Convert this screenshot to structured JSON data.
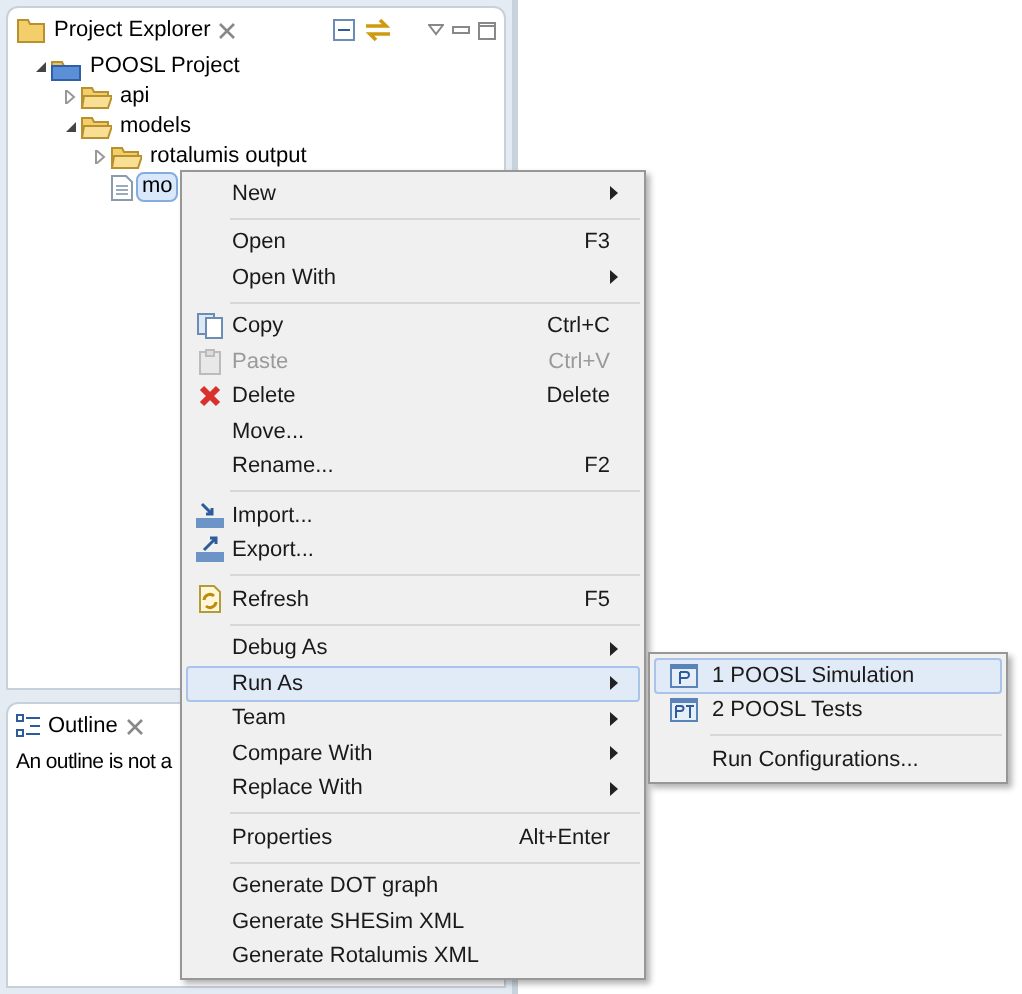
{
  "explorer": {
    "title": "Project Explorer",
    "tree": [
      {
        "label": "POOSL Project",
        "kind": "project",
        "expanded": true,
        "selected": false,
        "children": [
          {
            "label": "api",
            "kind": "folder",
            "expanded": false,
            "selected": false
          },
          {
            "label": "models",
            "kind": "folder",
            "expanded": true,
            "selected": false,
            "children": [
              {
                "label": "rotalumis output",
                "kind": "folder",
                "expanded": false,
                "selected": false
              },
              {
                "label": "mo",
                "kind": "file",
                "selected": true
              }
            ]
          }
        ]
      }
    ]
  },
  "outline": {
    "title": "Outline",
    "message": "An outline is not a"
  },
  "context_menu": {
    "items": [
      {
        "kind": "item",
        "label": "New",
        "submenu": true,
        "disabled": false,
        "selected": false
      },
      {
        "kind": "separator"
      },
      {
        "kind": "item",
        "label": "Open",
        "shortcut": "F3",
        "disabled": false,
        "selected": false
      },
      {
        "kind": "item",
        "label": "Open With",
        "submenu": true,
        "disabled": false,
        "selected": false
      },
      {
        "kind": "separator"
      },
      {
        "kind": "item",
        "label": "Copy",
        "shortcut": "Ctrl+C",
        "disabled": false,
        "selected": false
      },
      {
        "kind": "item",
        "label": "Paste",
        "shortcut": "Ctrl+V",
        "disabled": true,
        "selected": false
      },
      {
        "kind": "item",
        "label": "Delete",
        "shortcut": "Delete",
        "disabled": false,
        "selected": false
      },
      {
        "kind": "item",
        "label": "Move...",
        "disabled": false,
        "selected": false
      },
      {
        "kind": "item",
        "label": "Rename...",
        "shortcut": "F2",
        "disabled": false,
        "selected": false
      },
      {
        "kind": "separator"
      },
      {
        "kind": "item",
        "label": "Import...",
        "disabled": false,
        "selected": false
      },
      {
        "kind": "item",
        "label": "Export...",
        "disabled": false,
        "selected": false
      },
      {
        "kind": "separator"
      },
      {
        "kind": "item",
        "label": "Refresh",
        "shortcut": "F5",
        "disabled": false,
        "selected": false
      },
      {
        "kind": "separator"
      },
      {
        "kind": "item",
        "label": "Debug As",
        "submenu": true,
        "disabled": false,
        "selected": false
      },
      {
        "kind": "item",
        "label": "Run As",
        "submenu": true,
        "disabled": false,
        "selected": true
      },
      {
        "kind": "item",
        "label": "Team",
        "submenu": true,
        "disabled": false,
        "selected": false
      },
      {
        "kind": "item",
        "label": "Compare With",
        "submenu": true,
        "disabled": false,
        "selected": false
      },
      {
        "kind": "item",
        "label": "Replace With",
        "submenu": true,
        "disabled": false,
        "selected": false
      },
      {
        "kind": "separator"
      },
      {
        "kind": "item",
        "label": "Properties",
        "shortcut": "Alt+Enter",
        "disabled": false,
        "selected": false
      },
      {
        "kind": "separator"
      },
      {
        "kind": "item",
        "label": "Generate DOT graph",
        "disabled": false,
        "selected": false
      },
      {
        "kind": "item",
        "label": "Generate SHESim XML",
        "disabled": false,
        "selected": false
      },
      {
        "kind": "item",
        "label": "Generate Rotalumis XML",
        "disabled": false,
        "selected": false
      }
    ]
  },
  "submenu": {
    "items": [
      {
        "kind": "item",
        "label": "1 POOSL Simulation",
        "selected": true
      },
      {
        "kind": "item",
        "label": "2 POOSL Tests",
        "selected": false
      },
      {
        "kind": "separator"
      },
      {
        "kind": "item",
        "label": "Run Configurations...",
        "selected": false
      }
    ]
  }
}
